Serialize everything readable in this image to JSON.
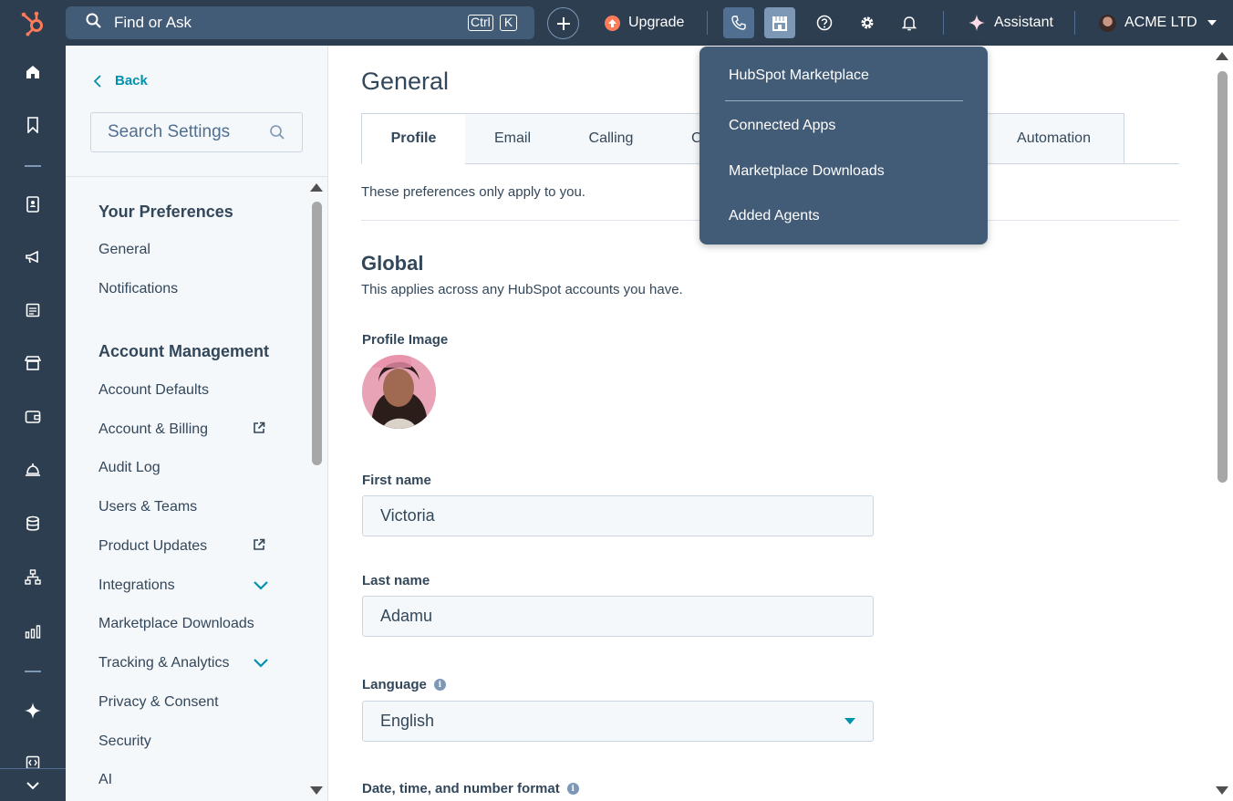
{
  "topbar": {
    "search_label": "Find or Ask",
    "kbd_ctrl": "Ctrl",
    "kbd_k": "K",
    "upgrade_label": "Upgrade",
    "assistant_label": "Assistant",
    "account_name": "ACME LTD"
  },
  "marketplace_menu": {
    "items": [
      "HubSpot Marketplace",
      "Connected Apps",
      "Marketplace Downloads",
      "Added Agents"
    ]
  },
  "sidebar": {
    "back_label": "Back",
    "search_placeholder": "Search Settings",
    "sections": [
      {
        "heading": "Your Preferences",
        "items": [
          "General",
          "Notifications"
        ]
      },
      {
        "heading": "Account Management",
        "items": [
          "Account Defaults",
          "Account & Billing",
          "Audit Log",
          "Users & Teams",
          "Product Updates",
          "Integrations",
          "Marketplace Downloads",
          "Tracking & Analytics",
          "Privacy & Consent",
          "Security",
          "AI"
        ]
      }
    ]
  },
  "main": {
    "title": "General",
    "tabs": [
      "Profile",
      "Email",
      "Calling",
      "C",
      "Automation"
    ],
    "preferences_note": "These preferences only apply to you.",
    "global_heading": "Global",
    "global_subtext": "This applies across any HubSpot accounts you have.",
    "profile_image_label": "Profile Image",
    "first_name_label": "First name",
    "first_name_value": "Victoria",
    "last_name_label": "Last name",
    "last_name_value": "Adamu",
    "language_label": "Language",
    "language_value": "English",
    "datetime_label": "Date, time, and number format"
  },
  "colors": {
    "nav_dark": "#2d3e50",
    "accent_teal": "#0091ae",
    "hubspot_orange": "#ff7a59",
    "menu_bg": "#425b76"
  }
}
